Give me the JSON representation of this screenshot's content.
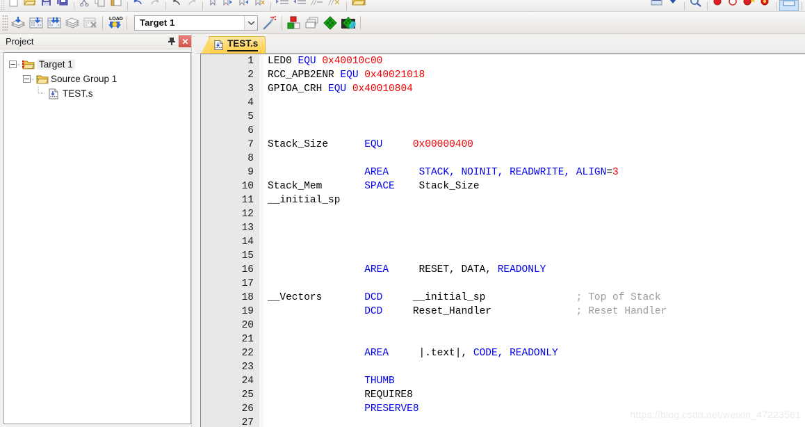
{
  "toolbar_top": {
    "icons": [
      "new-file-icon",
      "open-folder-icon",
      "save-icon",
      "save-all-icon",
      "cut-icon",
      "copy-icon",
      "paste-icon",
      "undo-icon",
      "redo-icon",
      "back-icon",
      "forward-icon",
      "bookmark-icon",
      "next-bookmark-icon",
      "prev-bookmark-icon",
      "clear-bookmarks-icon",
      "indent-icon",
      "outdent-icon",
      "comment-icon",
      "uncomment-icon",
      "open-project-icon",
      "debug-icon",
      "debug-options-icon",
      "find-icon",
      "insert-breakpoint-icon",
      "disable-breakpoint-icon",
      "kill-all-breakpoints-icon",
      "disable-all-breakpoints-icon",
      "window-icon"
    ]
  },
  "toolbar_main": {
    "buttons": [
      {
        "name": "translate-button",
        "icon": "translate-icon",
        "tooltip": "Translate"
      },
      {
        "name": "build-button",
        "icon": "build-icon",
        "tooltip": "Build"
      },
      {
        "name": "rebuild-button",
        "icon": "rebuild-icon",
        "tooltip": "Rebuild"
      },
      {
        "name": "batch-build-button",
        "icon": "batch-build-icon",
        "tooltip": "Batch Build"
      },
      {
        "name": "stop-build-button",
        "icon": "stop-build-icon",
        "tooltip": "Stop Build"
      },
      {
        "name": "download-button",
        "icon": "load-download-icon",
        "tooltip": "Download"
      }
    ],
    "target_value": "Target 1",
    "target_placeholder": "Target 1",
    "right_buttons": [
      {
        "name": "target-options-button",
        "icon": "magic-wand-icon",
        "tooltip": "Options for Target"
      },
      {
        "name": "manage-project-items-button",
        "icon": "project-components-icon",
        "tooltip": "Manage Project Items"
      },
      {
        "name": "multi-project-button",
        "icon": "multi-project-icon",
        "tooltip": "Manage Multi-Project Workspace"
      },
      {
        "name": "pack-installer-button",
        "icon": "pack-installer-icon",
        "tooltip": "Pack Installer"
      },
      {
        "name": "select-packs-button",
        "icon": "select-software-packs-icon",
        "tooltip": "Select Software Packs"
      }
    ]
  },
  "project_panel": {
    "title": "Project",
    "pin_icon": "pin-icon",
    "close_label": "✕",
    "tree": [
      {
        "label": "Target 1",
        "level": 0,
        "icon": "target-folder-icon",
        "expanded": true,
        "selected": true
      },
      {
        "label": "Source Group 1",
        "level": 1,
        "icon": "source-group-folder-icon",
        "expanded": true,
        "selected": false
      },
      {
        "label": "TEST.s",
        "level": 2,
        "icon": "asm-file-icon",
        "expanded": null,
        "selected": false
      }
    ]
  },
  "editor": {
    "tabs": [
      {
        "label": "TEST.s",
        "icon": "asm-file-icon",
        "active": true
      }
    ],
    "lines": [
      {
        "n": 1,
        "tokens": [
          {
            "t": "LED0 ",
            "c": "black"
          },
          {
            "t": "EQU ",
            "c": "blue"
          },
          {
            "t": "0x40010c00",
            "c": "red"
          }
        ]
      },
      {
        "n": 2,
        "tokens": [
          {
            "t": "RCC_APB2ENR ",
            "c": "black"
          },
          {
            "t": "EQU ",
            "c": "blue"
          },
          {
            "t": "0x40021018",
            "c": "red"
          }
        ]
      },
      {
        "n": 3,
        "tokens": [
          {
            "t": "GPIOA_CRH ",
            "c": "black"
          },
          {
            "t": "EQU ",
            "c": "blue"
          },
          {
            "t": "0x40010804",
            "c": "red"
          }
        ]
      },
      {
        "n": 4,
        "tokens": []
      },
      {
        "n": 5,
        "tokens": []
      },
      {
        "n": 6,
        "tokens": []
      },
      {
        "n": 7,
        "tokens": [
          {
            "t": "Stack_Size      ",
            "c": "black"
          },
          {
            "t": "EQU",
            "c": "blue"
          },
          {
            "t": "     ",
            "c": "black"
          },
          {
            "t": "0x00000400",
            "c": "red"
          }
        ]
      },
      {
        "n": 8,
        "tokens": []
      },
      {
        "n": 9,
        "tokens": [
          {
            "t": "                ",
            "c": "black"
          },
          {
            "t": "AREA",
            "c": "blue"
          },
          {
            "t": "     ",
            "c": "black"
          },
          {
            "t": "STACK, NOINIT, READWRITE, ALIGN",
            "c": "blue"
          },
          {
            "t": "=",
            "c": "black"
          },
          {
            "t": "3",
            "c": "red"
          }
        ]
      },
      {
        "n": 10,
        "tokens": [
          {
            "t": "Stack_Mem       ",
            "c": "black"
          },
          {
            "t": "SPACE",
            "c": "blue"
          },
          {
            "t": "    Stack_Size",
            "c": "black"
          }
        ]
      },
      {
        "n": 11,
        "tokens": [
          {
            "t": "__initial_sp",
            "c": "black"
          }
        ]
      },
      {
        "n": 12,
        "tokens": []
      },
      {
        "n": 13,
        "tokens": []
      },
      {
        "n": 14,
        "tokens": []
      },
      {
        "n": 15,
        "tokens": []
      },
      {
        "n": 16,
        "tokens": [
          {
            "t": "                ",
            "c": "black"
          },
          {
            "t": "AREA",
            "c": "blue"
          },
          {
            "t": "     RESET, DATA, ",
            "c": "black"
          },
          {
            "t": "READONLY",
            "c": "blue"
          }
        ]
      },
      {
        "n": 17,
        "tokens": []
      },
      {
        "n": 18,
        "tokens": [
          {
            "t": "__Vectors       ",
            "c": "black"
          },
          {
            "t": "DCD",
            "c": "blue"
          },
          {
            "t": "     __initial_sp               ",
            "c": "black"
          },
          {
            "t": "; Top of Stack",
            "c": "cmt"
          }
        ]
      },
      {
        "n": 19,
        "tokens": [
          {
            "t": "                ",
            "c": "black"
          },
          {
            "t": "DCD",
            "c": "blue"
          },
          {
            "t": "     Reset_Handler              ",
            "c": "black"
          },
          {
            "t": "; Reset Handler",
            "c": "cmt"
          }
        ]
      },
      {
        "n": 20,
        "tokens": []
      },
      {
        "n": 21,
        "tokens": []
      },
      {
        "n": 22,
        "tokens": [
          {
            "t": "                ",
            "c": "black"
          },
          {
            "t": "AREA",
            "c": "blue"
          },
          {
            "t": "     |.text|, ",
            "c": "black"
          },
          {
            "t": "CODE, READONLY",
            "c": "blue"
          }
        ]
      },
      {
        "n": 23,
        "tokens": []
      },
      {
        "n": 24,
        "tokens": [
          {
            "t": "                ",
            "c": "black"
          },
          {
            "t": "THUMB",
            "c": "blue"
          }
        ]
      },
      {
        "n": 25,
        "tokens": [
          {
            "t": "                REQUIRE8",
            "c": "black"
          }
        ]
      },
      {
        "n": 26,
        "tokens": [
          {
            "t": "                ",
            "c": "black"
          },
          {
            "t": "PRESERVE8",
            "c": "blue"
          }
        ]
      },
      {
        "n": 27,
        "tokens": []
      }
    ]
  },
  "watermark": "https://blog.csdn.net/weixin_47223561",
  "colors": {
    "keyword_blue": "#0000ee",
    "number_red": "#ee0000",
    "comment_gray": "#9b9b9b",
    "tab_yellow": "#ffd766",
    "panel_gray": "#f2f1ef",
    "gutter_gray": "#e8e8e8"
  }
}
